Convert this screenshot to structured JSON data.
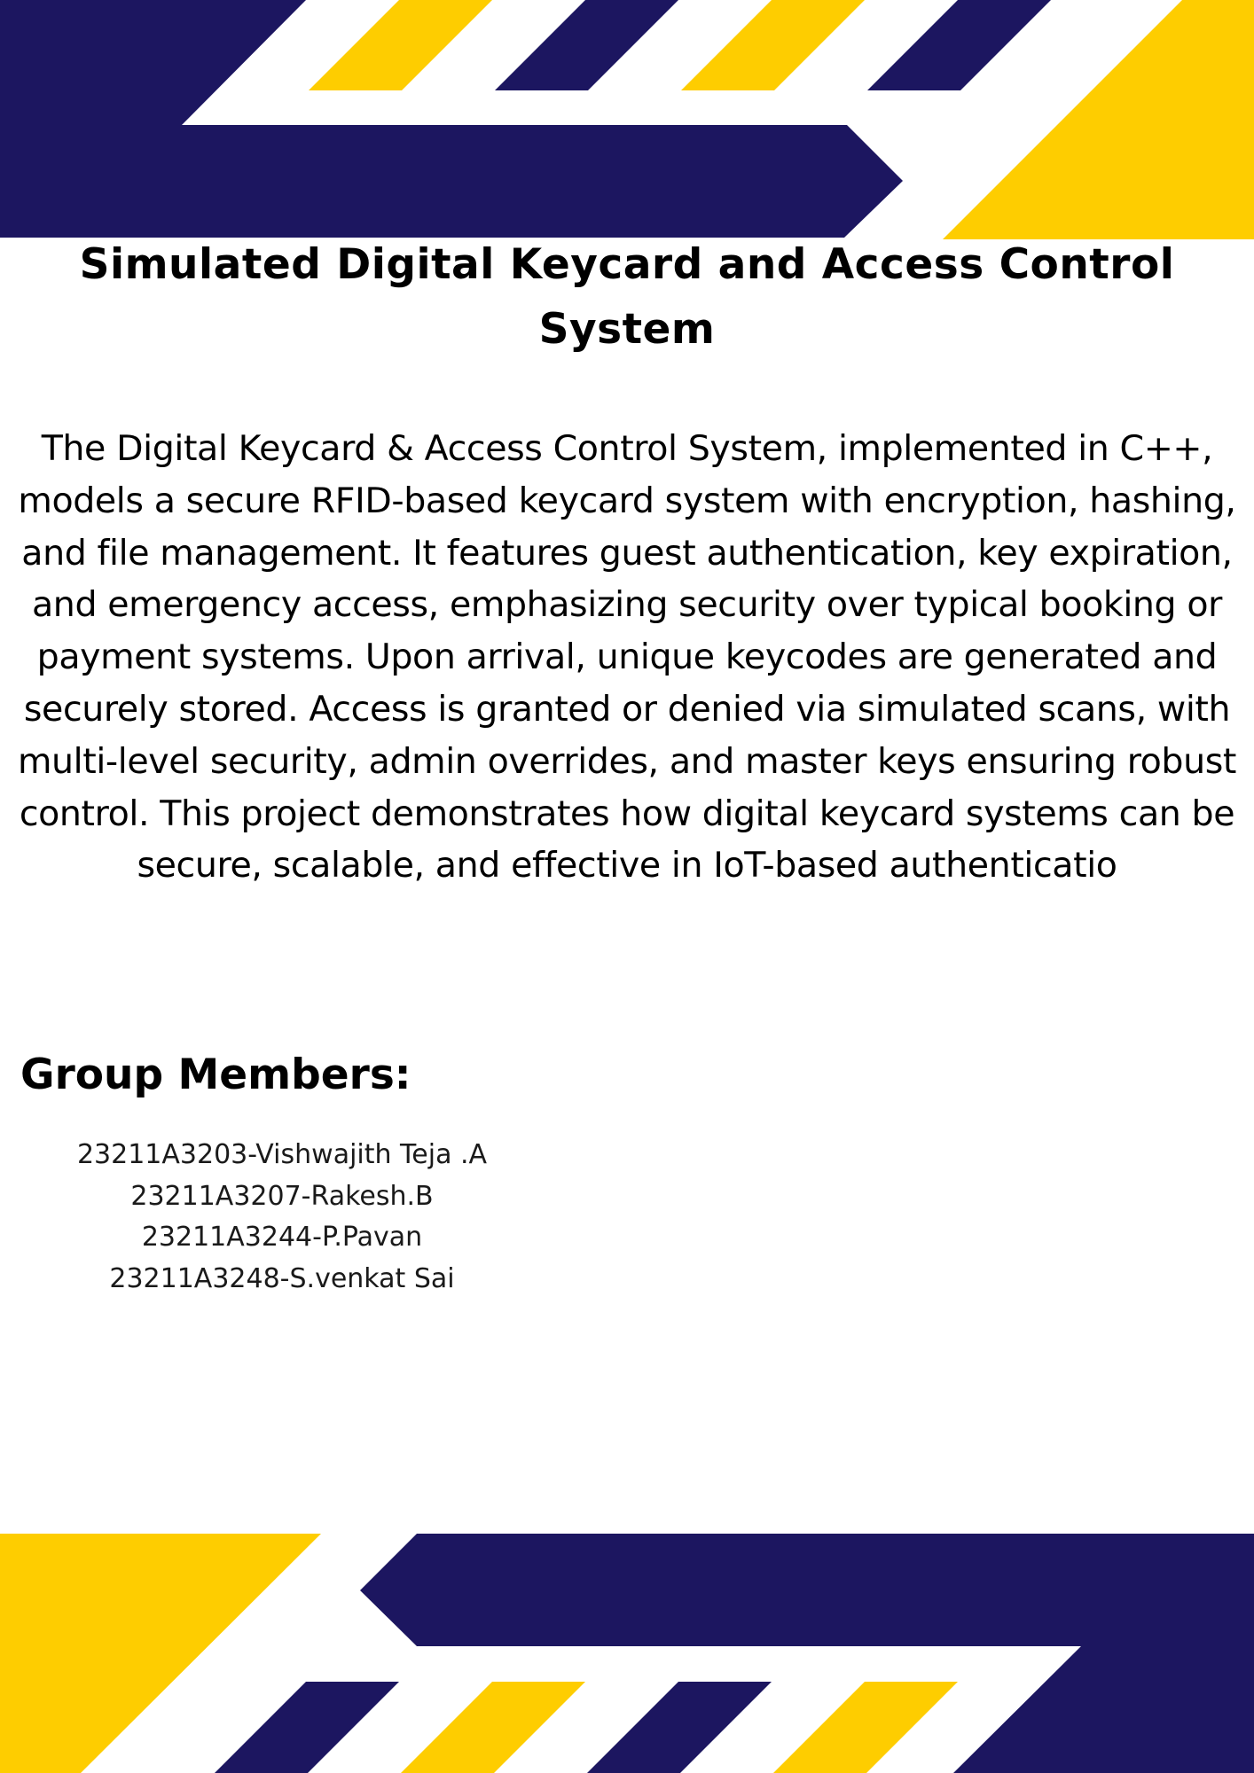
{
  "colors": {
    "navy": "#1c1660",
    "yellow": "#fecd00",
    "background": "#ffffff",
    "text": "#000000"
  },
  "title": "Simulated Digital Keycard and Access Control System",
  "abstract": "The Digital Keycard & Access Control System, implemented in C++, models a secure RFID-based keycard system with encryption, hashing, and file management. It features guest authentication, key expiration, and emergency access, emphasizing security over typical booking or payment systems. Upon arrival, unique keycodes are generated and securely stored. Access is granted or denied via simulated scans, with multi-level security, admin overrides, and master keys ensuring robust control. This project demonstrates how digital keycard systems can be secure, scalable, and effective in IoT-based authenticatio",
  "members": {
    "heading": "Group Members:",
    "list": [
      "23211A3203-Vishwajith Teja .A",
      "23211A3207-Rakesh.B",
      "23211A3244-P.Pavan",
      "23211A3248-S.venkat Sai"
    ]
  }
}
